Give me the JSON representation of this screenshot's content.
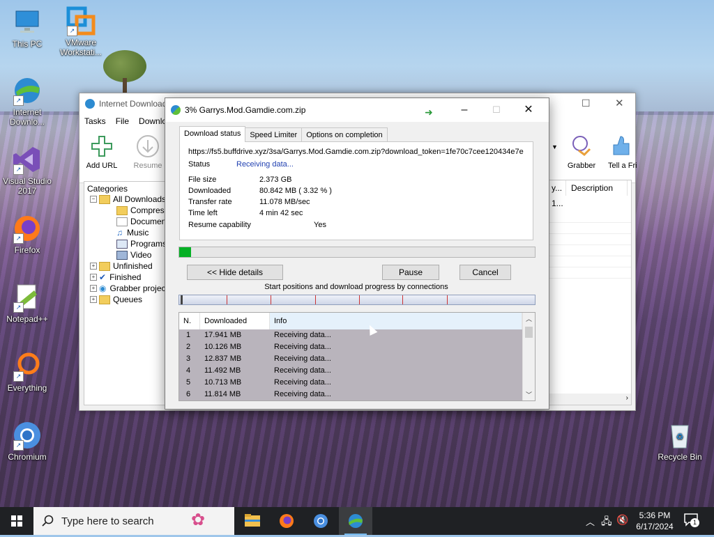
{
  "desktop": {
    "icons": [
      {
        "label": "This PC"
      },
      {
        "label": "VMware Workstati..."
      },
      {
        "label": "Internet Downlo..."
      },
      {
        "label": "Visual Studio 2017"
      },
      {
        "label": "Firefox"
      },
      {
        "label": "Notepad++"
      },
      {
        "label": "Everything"
      },
      {
        "label": "Chromium"
      },
      {
        "label": "Recycle Bin"
      }
    ]
  },
  "main_window": {
    "title": "Internet Download",
    "menu": [
      "Tasks",
      "File",
      "Downlo"
    ],
    "toolbar": {
      "add_url": "Add URL",
      "resume": "Resume",
      "grabber": "Grabber",
      "tell": "Tell a Fri"
    },
    "categories": {
      "header": "Categories",
      "items": [
        "All Downloads",
        "Compresse",
        "Documents",
        "Music",
        "Programs",
        "Video",
        "Unfinished",
        "Finished",
        "Grabber projec",
        "Queues"
      ]
    },
    "columns": {
      "c1": "y...",
      "description": "Description"
    },
    "row1": "1..."
  },
  "dialog": {
    "title": "3% Garrys.Mod.Gamdie.com.zip",
    "tabs": [
      "Download status",
      "Speed Limiter",
      "Options on completion"
    ],
    "url": "https://fs5.buffdrive.xyz/3sa/Garrys.Mod.Gamdie.com.zip?download_token=1fe70c7cee120434e7e",
    "status_label": "Status",
    "status_value": "Receiving data...",
    "file_size_label": "File size",
    "file_size_value": "2.373  GB",
    "downloaded_label": "Downloaded",
    "downloaded_value": "80.842  MB  ( 3.32 % )",
    "transfer_rate_label": "Transfer rate",
    "transfer_rate_value": "11.078  MB/sec",
    "time_left_label": "Time left",
    "time_left_value": "4 min 42 sec",
    "resume_label": "Resume capability",
    "resume_value": "Yes",
    "progress_fraction": 0.0332,
    "buttons": {
      "hide_details": "<< Hide details",
      "pause": "Pause",
      "cancel": "Cancel"
    },
    "connections_label": "Start positions and download progress by connections",
    "table": {
      "headers": [
        "N.",
        "Downloaded",
        "Info"
      ],
      "rows": [
        {
          "n": "1",
          "downloaded": "17.941  MB",
          "info": "Receiving data..."
        },
        {
          "n": "2",
          "downloaded": "10.126  MB",
          "info": "Receiving data..."
        },
        {
          "n": "3",
          "downloaded": "12.837  MB",
          "info": "Receiving data..."
        },
        {
          "n": "4",
          "downloaded": "11.492  MB",
          "info": "Receiving data..."
        },
        {
          "n": "5",
          "downloaded": "10.713  MB",
          "info": "Receiving data..."
        },
        {
          "n": "6",
          "downloaded": "11.814  MB",
          "info": "Receiving data..."
        }
      ]
    }
  },
  "taskbar": {
    "search_placeholder": "Type here to search",
    "time": "5:36 PM",
    "date": "6/17/2024",
    "notification_count": "1"
  },
  "colors": {
    "progress": "#06b025",
    "status_blue": "#1f3fb0",
    "taskbar": "#1f2124"
  }
}
